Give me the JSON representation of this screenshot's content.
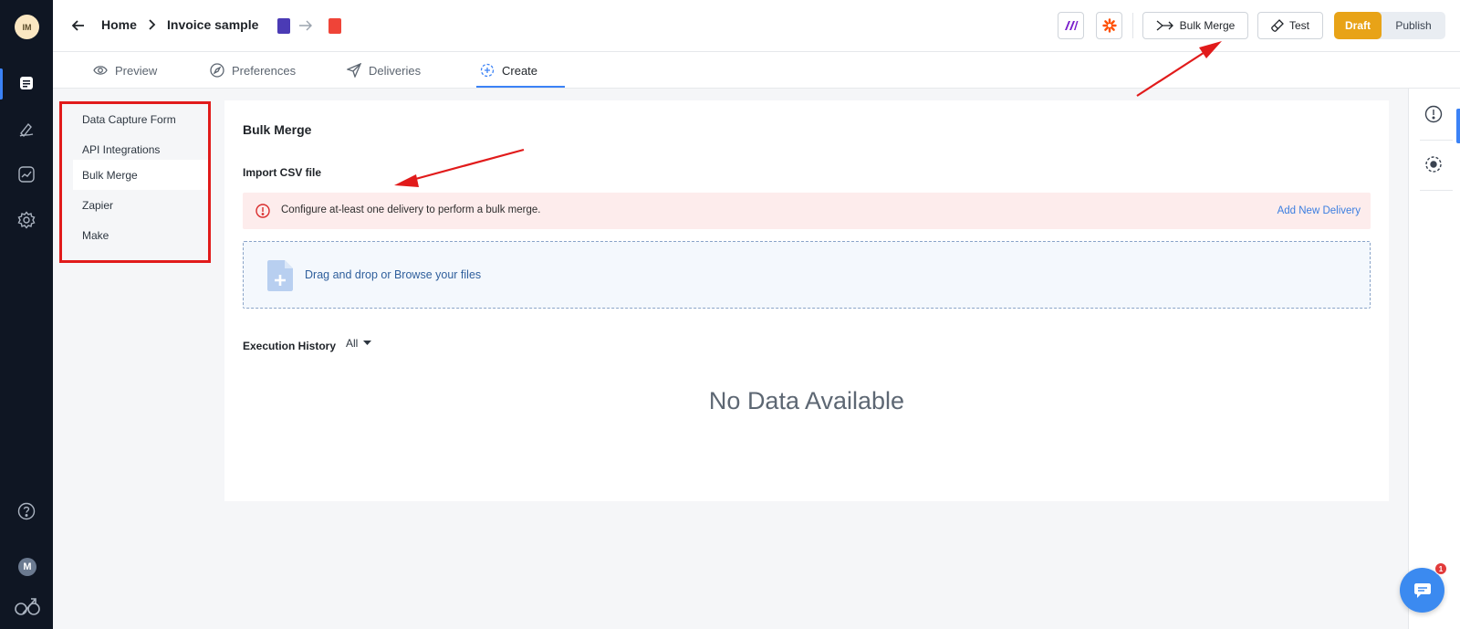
{
  "user": {
    "initials": "IM",
    "secondary_initial": "M"
  },
  "breadcrumb": {
    "home": "Home",
    "document": "Invoice sample"
  },
  "toolbar": {
    "bulk_merge_label": "Bulk Merge",
    "test_label": "Test",
    "draft_label": "Draft",
    "publish_label": "Publish"
  },
  "tabs": [
    {
      "label": "Preview",
      "icon": "eye-icon",
      "active": false
    },
    {
      "label": "Preferences",
      "icon": "compass-icon",
      "active": false
    },
    {
      "label": "Deliveries",
      "icon": "send-icon",
      "active": false
    },
    {
      "label": "Create",
      "icon": "create-icon",
      "active": true
    }
  ],
  "sidenav": {
    "items": [
      {
        "label": "Data Capture Form",
        "active": false
      },
      {
        "label": "API Integrations",
        "active": false
      },
      {
        "label": "Bulk Merge",
        "active": true
      },
      {
        "label": "Zapier",
        "active": false
      },
      {
        "label": "Make",
        "active": false
      }
    ]
  },
  "main": {
    "title": "Bulk Merge",
    "import_label": "Import CSV file",
    "alert_text": "Configure at-least one delivery to perform a bulk merge.",
    "alert_link": "Add New Delivery",
    "dropzone_text": "Drag and drop or Browse your files",
    "history_label": "Execution History",
    "history_filter": "All",
    "empty_text": "No Data Available"
  },
  "chat": {
    "badge": "1"
  },
  "colors": {
    "accent": "#3b82f6",
    "draft": "#e8a317",
    "alert_bg": "#fdecec",
    "annotation": "#e11b1b"
  }
}
